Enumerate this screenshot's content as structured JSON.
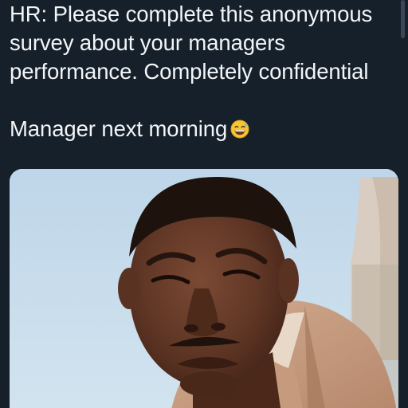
{
  "post": {
    "lines": [
      "HR: Please complete this anonymous",
      "survey about your managers",
      "performance. Completely confidential",
      "Manager next morning"
    ],
    "emoji": "sweat-smile-emoji"
  },
  "media": {
    "subject": "man-squinting-photo"
  },
  "colors": {
    "background": "#15202b",
    "text": "#f3f5f7",
    "sky": "#c6dbea",
    "suit": "#c59a7e"
  }
}
